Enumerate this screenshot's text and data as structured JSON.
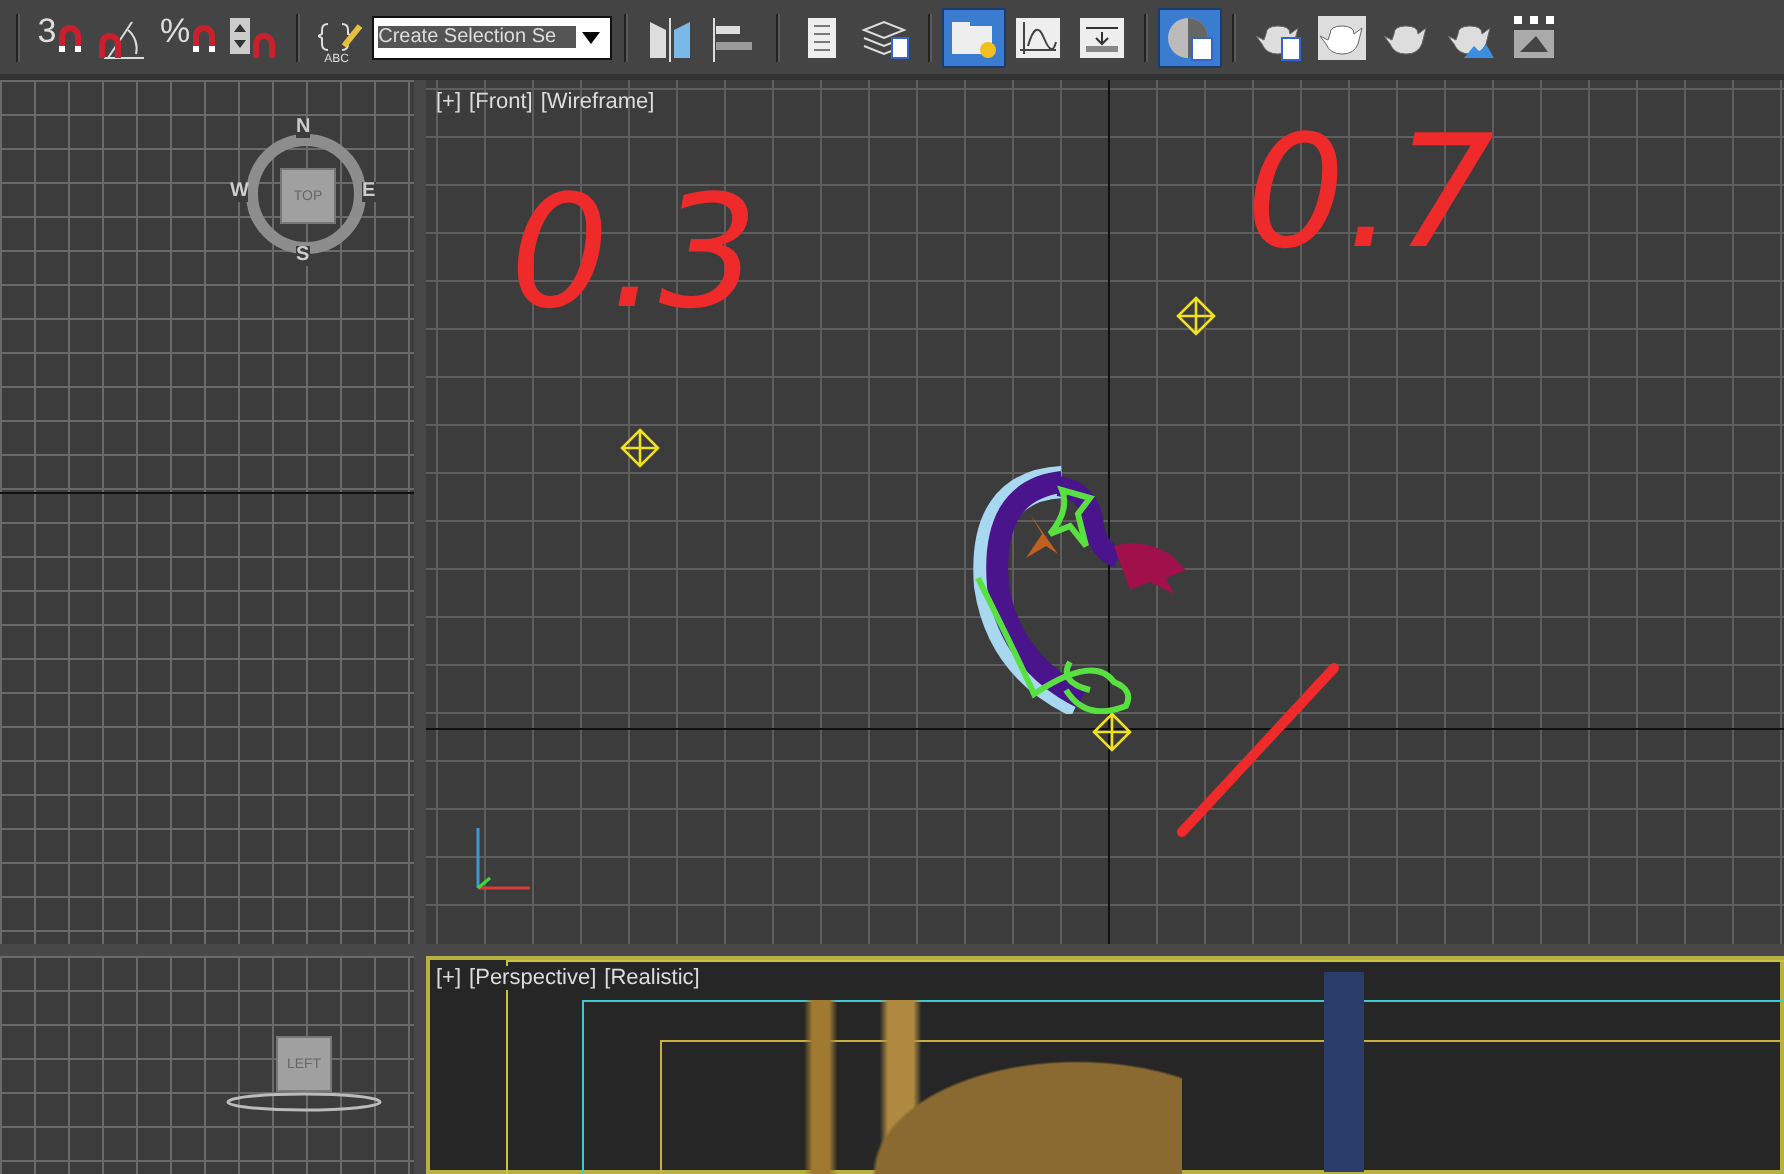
{
  "toolbar": {
    "groups": [
      [
        {
          "kind": "snap",
          "label": "3",
          "selected": false
        },
        {
          "kind": "angle-snap",
          "selected": false
        },
        {
          "kind": "snap",
          "label": "%",
          "selected": false
        },
        {
          "kind": "spinner-snap",
          "selected": false
        }
      ],
      [
        {
          "kind": "named-selection",
          "label": "ABC",
          "selected": false
        },
        {
          "kind": "dropdown",
          "value": "Create Selection Se"
        }
      ],
      [
        {
          "kind": "mirror",
          "selected": false
        },
        {
          "kind": "align",
          "selected": false
        }
      ],
      [
        {
          "kind": "list",
          "selected": false
        },
        {
          "kind": "layers",
          "selected": false
        }
      ],
      [
        {
          "kind": "explorer",
          "selected": true
        },
        {
          "kind": "curve",
          "selected": false
        },
        {
          "kind": "schematic",
          "selected": false
        }
      ],
      [
        {
          "kind": "material",
          "selected": true
        }
      ],
      [
        {
          "kind": "teapot-setup",
          "selected": false
        },
        {
          "kind": "teapot-frame",
          "selected": false
        },
        {
          "kind": "teapot",
          "selected": false
        },
        {
          "kind": "teapot-cloud",
          "selected": false
        },
        {
          "kind": "image",
          "selected": false
        }
      ]
    ]
  },
  "top_viewport": {
    "compass": [
      "N",
      "W",
      "E",
      "S"
    ],
    "cube_label": "TOP",
    "active": false
  },
  "front_viewport": {
    "labels": [
      "[+]",
      "[Front]",
      "[Wireframe]"
    ],
    "annotations": [
      "0.3",
      "0.7"
    ],
    "active": false
  },
  "left_viewport": {
    "cube_label": "LEFT",
    "active": false
  },
  "perspective_viewport": {
    "labels": [
      "[+]",
      "[Perspective]",
      "[Realistic]"
    ],
    "active": true
  }
}
